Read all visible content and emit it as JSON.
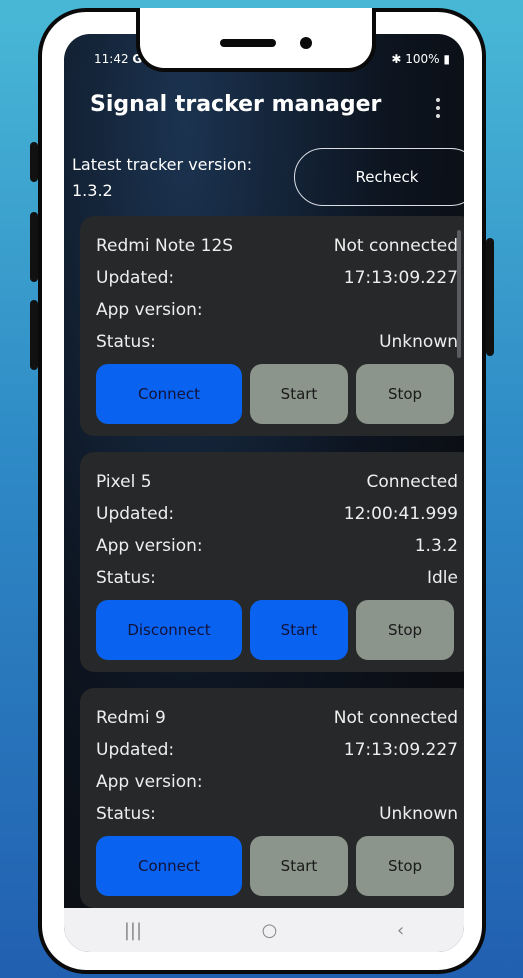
{
  "status_bar": {
    "time": "11:42",
    "network_glyph": "G",
    "battery": "100%"
  },
  "app": {
    "title": "Signal tracker manager",
    "menu_icon": "more-vert-icon"
  },
  "header": {
    "latest_label": "Latest tracker version:",
    "latest_value": "1.3.2",
    "recheck_label": "Recheck"
  },
  "devices": [
    {
      "name": "Redmi Note 12S",
      "connection": "Not connected",
      "updated_label": "Updated:",
      "updated_value": "17:13:09.227",
      "app_version_label": "App version:",
      "app_version_value": "",
      "status_label": "Status:",
      "status_value": "Unknown",
      "buttons": {
        "connect": "Connect",
        "start": "Start",
        "stop": "Stop"
      }
    },
    {
      "name": "Pixel 5",
      "connection": "Connected",
      "updated_label": "Updated:",
      "updated_value": "12:00:41.999",
      "app_version_label": "App version:",
      "app_version_value": "1.3.2",
      "status_label": "Status:",
      "status_value": "Idle",
      "buttons": {
        "connect": "Disconnect",
        "start": "Start",
        "stop": "Stop"
      }
    },
    {
      "name": "Redmi 9",
      "connection": "Not connected",
      "updated_label": "Updated:",
      "updated_value": "17:13:09.227",
      "app_version_label": "App version:",
      "app_version_value": "",
      "status_label": "Status:",
      "status_value": "Unknown",
      "buttons": {
        "connect": "Connect",
        "start": "Start",
        "stop": "Stop"
      }
    }
  ],
  "nav": {
    "recents": "|||",
    "home": "○",
    "back": "‹"
  },
  "colors": {
    "primary_button": "#0a63f0",
    "disabled_button": "#8b958c",
    "card": "#262829"
  }
}
